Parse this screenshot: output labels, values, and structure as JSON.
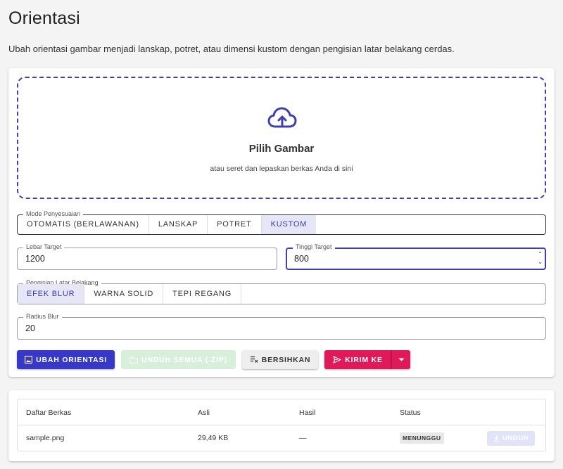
{
  "page": {
    "title": "Orientasi",
    "description": "Ubah orientasi gambar menjadi lanskap, potret, atau dimensi kustom dengan pengisian latar belakang cerdas."
  },
  "upload": {
    "heading": "Pilih Gambar",
    "hint": "atau seret dan lepaskan berkas Anda di sini",
    "icon": "cloud-upload-icon",
    "icon_color": "#3f3fb0"
  },
  "mode": {
    "label": "Mode Penyesuaian",
    "options": [
      "OTOMATIS (BERLAWANAN)",
      "LANSKAP",
      "POTRET",
      "KUSTOM"
    ],
    "selected": "KUSTOM"
  },
  "width_field": {
    "label": "Lebar Target",
    "value": "1200"
  },
  "height_field": {
    "label": "Tinggi Target",
    "value": "800"
  },
  "background": {
    "label": "Pengisian Latar Belakang",
    "options": [
      "EFEK BLUR",
      "WARNA SOLID",
      "TEPI REGANG"
    ],
    "selected": "EFEK BLUR"
  },
  "blur_field": {
    "label": "Radius Blur",
    "value": "20"
  },
  "actions": {
    "convert": "UBAH ORIENTASI",
    "download_all": "UNDUH SEMUA (.ZIP)",
    "clear": "BERSIHKAN",
    "send": "KIRIM KE"
  },
  "table": {
    "headers": [
      "Daftar Berkas",
      "Asli",
      "Hasil",
      "Status"
    ],
    "rows": [
      {
        "name": "sample.png",
        "original": "29,49 KB",
        "result": "—",
        "status": "MENUNGGU",
        "download": "UNDUH"
      }
    ]
  },
  "colors": {
    "primary": "#3838c8",
    "accent": "#e0195a",
    "success_disabled": "#d8efda",
    "selected_bg": "#e6e6f7"
  }
}
